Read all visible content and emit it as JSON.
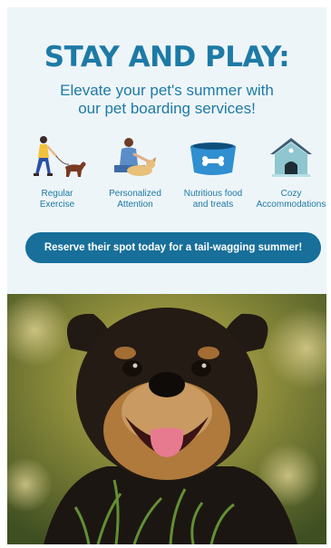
{
  "headline": "STAY AND PLAY:",
  "subheadline_line1": "Elevate your pet's summer with",
  "subheadline_line2": "our pet boarding services!",
  "features": [
    {
      "icon": "walking-dog-icon",
      "line1": "Regular",
      "line2": "Exercise"
    },
    {
      "icon": "person-petting-dog-icon",
      "line1": "Personalized",
      "line2": "Attention"
    },
    {
      "icon": "dog-bowl-icon",
      "line1": "Nutritious food",
      "line2": "and treats"
    },
    {
      "icon": "dog-house-icon",
      "line1": "Cozy",
      "line2": "Accommodations"
    }
  ],
  "cta_label": "Reserve their spot today for a tail-wagging summer!",
  "colors": {
    "background": "#eef5f8",
    "brand_blue": "#1d7aa6",
    "cta_blue": "#176f9a"
  }
}
